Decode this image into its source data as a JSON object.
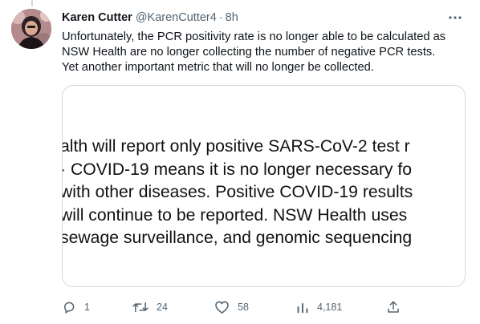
{
  "tweet": {
    "author_name": "Karen Cutter",
    "author_handle": "@KarenCutter4",
    "separator": "·",
    "time": "8h",
    "text_lines": [
      "Unfortunately, the PCR positivity rate is no longer able to be calculated as",
      "NSW Health are no longer collecting the number of negative PCR tests.",
      "Yet another important metric that will no longer be collected."
    ]
  },
  "media": {
    "lines": [
      "alth will report only positive SARS-CoV-2 test r",
      "· COVID-19 means it is no longer necessary fo",
      "with other diseases. Positive COVID-19 results",
      " will continue to be reported. NSW Health uses",
      "sewage surveillance, and genomic sequencing"
    ]
  },
  "actions": {
    "reply": {
      "icon": "reply-icon",
      "count": "1"
    },
    "retweet": {
      "icon": "retweet-icon",
      "count": "24"
    },
    "like": {
      "icon": "heart-icon",
      "count": "58"
    },
    "views": {
      "icon": "analytics-icon",
      "count": "4,181"
    },
    "share": {
      "icon": "share-icon"
    }
  },
  "colors": {
    "text_primary": "#0f1419",
    "text_secondary": "#536471",
    "border": "#cfd9de"
  }
}
